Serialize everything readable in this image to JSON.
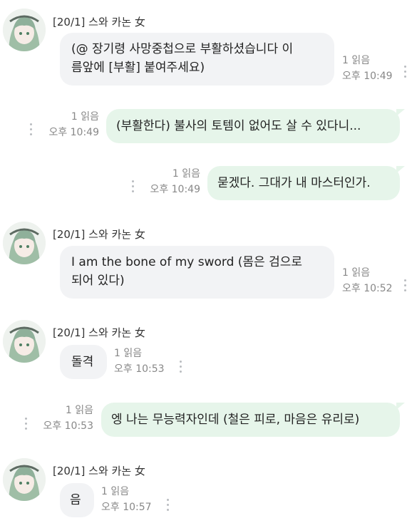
{
  "sender": {
    "name": "[20/1] 스와 카논 女"
  },
  "messages": [
    {
      "dir": "in",
      "lines": [
        "(@ 장기령 사망중첩으로 부활하셨습니다 이",
        "름앞에 [부활] 붙여주세요)"
      ],
      "read": "1 읽음",
      "time": "오후 10:49"
    },
    {
      "dir": "out",
      "text": "(부활한다) 불사의 토템이 없어도 살 수 있다니...",
      "read": "1 읽음",
      "time": "오후 10:49"
    },
    {
      "dir": "out",
      "text": "묻겠다. 그대가 내 마스터인가.",
      "read": "1 읽음",
      "time": "오후 10:49"
    },
    {
      "dir": "in",
      "lines": [
        "I am the bone of my sword (몸은 검으로",
        "되어 있다)"
      ],
      "read": "1 읽음",
      "time": "오후 10:52"
    },
    {
      "dir": "in",
      "text": "돌격",
      "read": "1 읽음",
      "time": "오후 10:53"
    },
    {
      "dir": "out",
      "text": "엥 나는 무능력자인데 (철은 피로, 마음은 유리로)",
      "read": "1 읽음",
      "time": "오후 10:53"
    },
    {
      "dir": "in",
      "text": "음",
      "read": "1 읽음",
      "time": "오후 10:57"
    }
  ],
  "icons": {
    "avatar": "anime-avatar-green-hair",
    "more": "vertical-dots-icon"
  },
  "colors": {
    "incoming_bubble": "#f2f3f5",
    "outgoing_bubble": "#e6f5ea",
    "meta_text": "#888888"
  }
}
